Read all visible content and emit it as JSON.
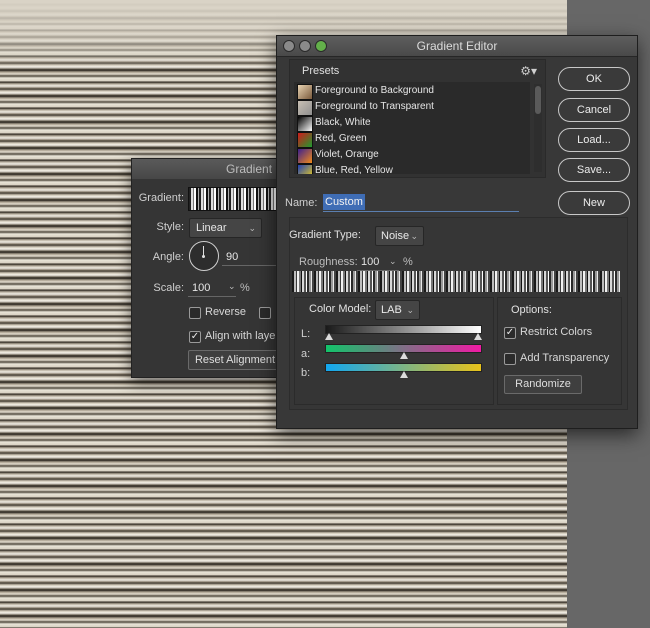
{
  "gradient_fill": {
    "title": "Gradient F",
    "gradient_label": "Gradient:",
    "style_label": "Style:",
    "style_value": "Linear",
    "angle_label": "Angle:",
    "angle_value": "90",
    "scale_label": "Scale:",
    "scale_value": "100",
    "scale_unit": "%",
    "reverse_label": "Reverse",
    "reverse_checked": false,
    "dither_label": "",
    "dither_checked": false,
    "align_label": "Align with layer",
    "align_checked": true,
    "reset_label": "Reset Alignment"
  },
  "gradient_editor": {
    "title": "Gradient Editor",
    "presets": {
      "label": "Presets",
      "items": [
        {
          "label": "Foreground to Background",
          "swatch": [
            "#e9d4b3",
            "#7a5a3c"
          ]
        },
        {
          "label": "Foreground to Transparent",
          "swatch": [
            "#c9c0b4",
            "#8f8f8f"
          ]
        },
        {
          "label": "Black, White",
          "swatch": [
            "#000000",
            "#ffffff"
          ]
        },
        {
          "label": "Red, Green",
          "swatch": [
            "#d11a1a",
            "#1f9a2f"
          ]
        },
        {
          "label": "Violet, Orange",
          "swatch": [
            "#3b1f8f",
            "#f28a1a"
          ]
        },
        {
          "label": "Blue, Red, Yellow",
          "swatch": [
            "#1f3fb3",
            "#f2d21a"
          ]
        }
      ]
    },
    "buttons": {
      "ok": "OK",
      "cancel": "Cancel",
      "load": "Load...",
      "save": "Save...",
      "new": "New"
    },
    "name_label": "Name:",
    "name_value": "Custom",
    "gradient_type_label": "Gradient Type:",
    "gradient_type_value": "Noise",
    "roughness_label": "Roughness:",
    "roughness_value": "100",
    "roughness_unit": "%",
    "color_model_label": "Color Model:",
    "color_model_value": "LAB",
    "channels": [
      {
        "label": "L:",
        "colors": [
          "#1a1a1a",
          "#ffffff"
        ],
        "stop_low": 0.0,
        "stop_high": 1.0
      },
      {
        "label": "a:",
        "colors": [
          "#12c46a",
          "#f01aa4"
        ],
        "stop_low": 0.5,
        "stop_high": 0.5
      },
      {
        "label": "b:",
        "colors": [
          "#12a7f0",
          "#e8c21a"
        ],
        "stop_low": 0.5,
        "stop_high": 0.5
      }
    ],
    "options": {
      "label": "Options:",
      "restrict_colors_label": "Restrict Colors",
      "restrict_colors_checked": true,
      "add_transparency_label": "Add Transparency",
      "add_transparency_checked": false,
      "randomize_label": "Randomize"
    }
  }
}
